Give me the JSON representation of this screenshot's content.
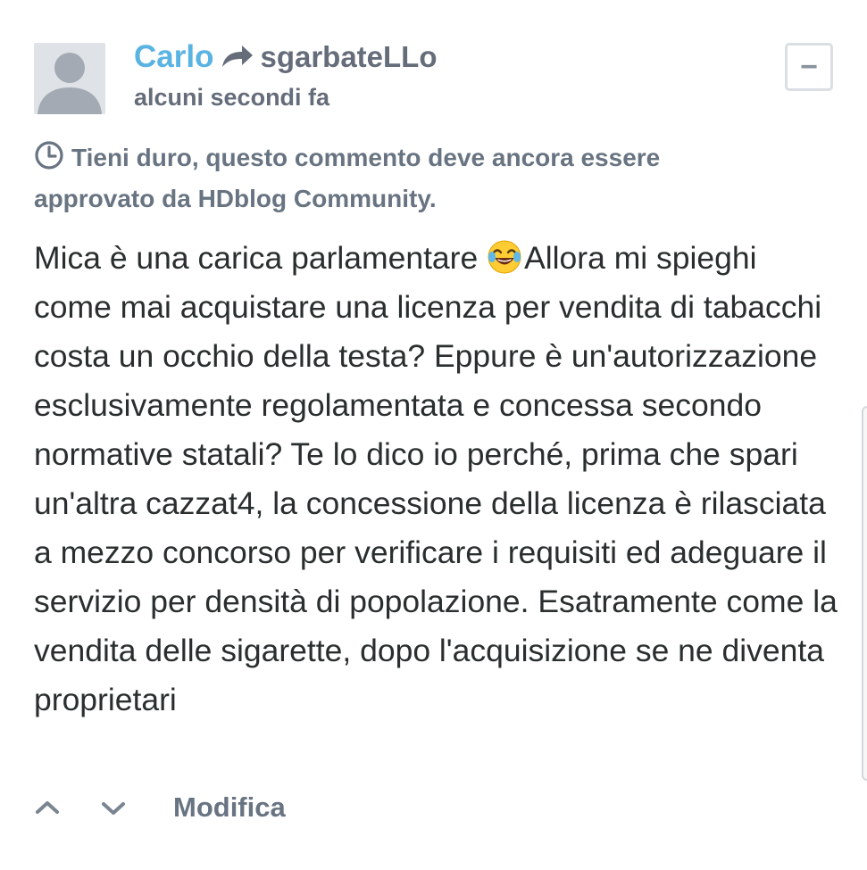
{
  "comment": {
    "author": "Carlo",
    "reply_icon": "reply-arrow-icon",
    "reply_to": "sgarbateLLo",
    "timestamp": "alcuni secondi fa",
    "collapse_label": "−",
    "pending_icon": "clock-icon",
    "pending_notice": "Tieni duro, questo commento deve ancora essere approvato da HDblog Community.",
    "body_before_emoji": "Mica è una carica parlamentare ",
    "emoji": "face-with-tears-of-joy-emoji",
    "body_after_emoji": "Allora mi spieghi come mai acquistare una licenza per vendita di tabacchi costa un occhio della testa? Eppure è un'autorizzazione esclusivamente regolamentata e concessa secondo normative statali? Te lo dico io perché, prima che spari un'altra cazzat4, la concessione della licenza è rilasciata a mezzo concorso per verificare i requisiti ed adeguare il servizio per densità di popolazione. Esatramente come la vendita delle sigarette, dopo l'acquisizione se ne diventa proprietari"
  },
  "footer": {
    "upvote_icon": "chevron-up-icon",
    "downvote_icon": "chevron-down-icon",
    "edit_label": "Modifica"
  },
  "colors": {
    "author": "#59b3e3",
    "meta_text": "#656c7a",
    "body_text": "#2a2e2e",
    "avatar_bg": "#dfe3e7",
    "avatar_figure": "#a3aab3"
  }
}
